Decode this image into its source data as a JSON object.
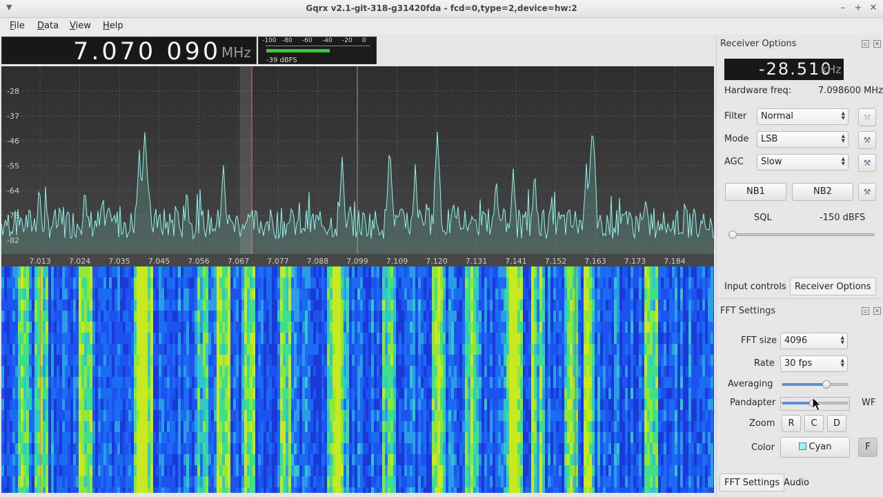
{
  "window": {
    "title": "Gqrx v2.1-git-318-g31420fda - fcd=0,type=2,device=hw:2"
  },
  "menu": [
    "File",
    "Data",
    "View",
    "Help"
  ],
  "frequency": {
    "value": "7.070 090",
    "unit": "MHz"
  },
  "meter": {
    "scale": [
      "-100",
      "-80",
      "-60",
      "-40",
      "-20",
      "0"
    ],
    "level_fraction": 0.61,
    "readout": "-39 dBFS"
  },
  "spectrum": {
    "y_ticks": [
      "-28",
      "-37",
      "-46",
      "-55",
      "-64",
      "-73",
      "-82"
    ],
    "x_ticks": [
      "7.013",
      "7.024",
      "7.035",
      "7.045",
      "7.056",
      "7.067",
      "7.077",
      "7.088",
      "7.099",
      "7.109",
      "7.120",
      "7.131",
      "7.141",
      "7.152",
      "7.163",
      "7.173",
      "7.184"
    ]
  },
  "receiver_options": {
    "title": "Receiver Options",
    "offset": {
      "value": "-28.510",
      "unit": "kHz"
    },
    "hw_freq_label": "Hardware freq:",
    "hw_freq_value": "7.098600 MHz",
    "filter": {
      "label": "Filter",
      "value": "Normal"
    },
    "mode": {
      "label": "Mode",
      "value": "LSB"
    },
    "agc": {
      "label": "AGC",
      "value": "Slow"
    },
    "nb1": "NB1",
    "nb2": "NB2",
    "sql_label": "SQL",
    "sql_value": "-150 dBFS",
    "sql_level": 0.0
  },
  "tabs_top": {
    "input": "Input controls",
    "receiver": "Receiver Options"
  },
  "fft_settings": {
    "title": "FFT Settings",
    "fft_size": {
      "label": "FFT size",
      "value": "4096"
    },
    "rate": {
      "label": "Rate",
      "value": "30 fps"
    },
    "averaging": {
      "label": "Averaging",
      "level": 0.7
    },
    "pandapter": {
      "label": "Pandapter",
      "level": 0.47,
      "right_label": "WF"
    },
    "zoom": {
      "label": "Zoom",
      "r": "R",
      "c": "C",
      "d": "D"
    },
    "color": {
      "label": "Color",
      "value": "Cyan",
      "swatch": "#8ff5f0",
      "f": "F"
    }
  },
  "tabs_bottom": {
    "fft": "FFT Settings",
    "audio": "Audio"
  }
}
